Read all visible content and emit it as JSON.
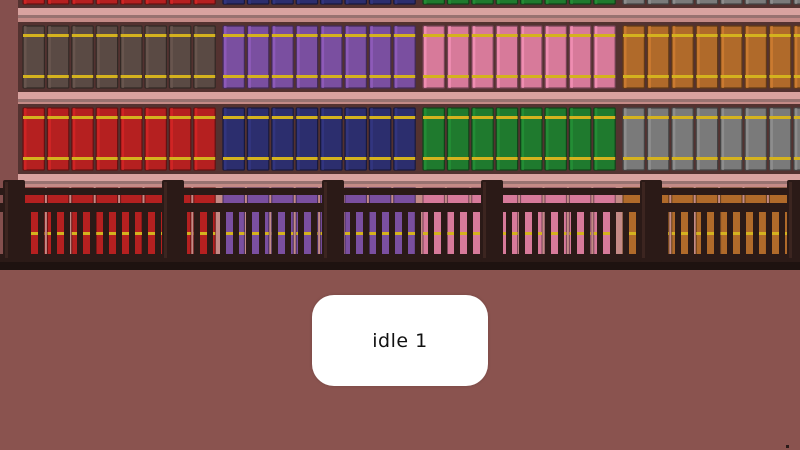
{
  "scene": {
    "label": "idle 1",
    "colors": {
      "wall": "#c48a86",
      "shelf_wood": "#6e4240",
      "shelf_trim": "#d9a3a0",
      "floor": "#8a534f",
      "railing": "#2b1a17",
      "book_band": "#d4b21e"
    },
    "shelf_rows": [
      {
        "book_colors": [
          "#b52020",
          "#2c2e6e",
          "#1f7a2e",
          "#7a7a7a"
        ]
      },
      {
        "book_colors": [
          "#5a4a44",
          "#7a4fa0",
          "#d77a9a",
          "#b06a2a"
        ]
      },
      {
        "book_colors": [
          "#b52020",
          "#2c2e6e",
          "#1f7a2e",
          "#7a7a7a"
        ]
      }
    ],
    "books_per_group": 8
  }
}
